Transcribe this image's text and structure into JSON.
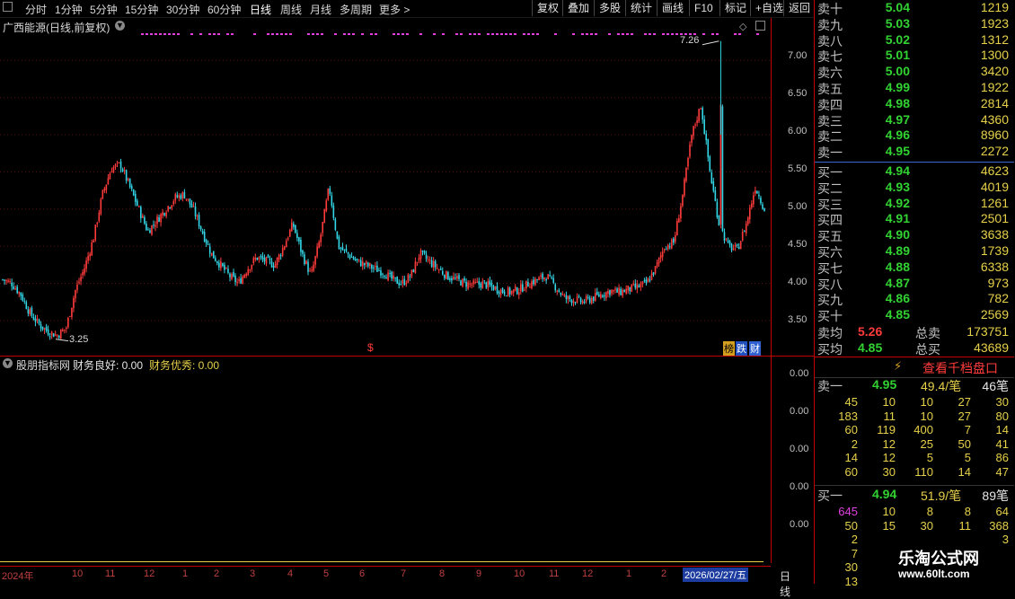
{
  "toolbar": {
    "periods": [
      "分时",
      "1分钟",
      "5分钟",
      "15分钟",
      "30分钟",
      "60分钟",
      "日线",
      "周线",
      "月线",
      "多周期",
      "更多 >"
    ],
    "active_period": "日线",
    "buttons": [
      "复权",
      "叠加",
      "多股",
      "统计",
      "画线",
      "F10",
      "标记",
      "+自选",
      "返回"
    ]
  },
  "chart": {
    "title": "广西能源(日线,前复权)",
    "high_label": "7.26",
    "low_label": "3.25",
    "price_axis": [
      "7.00",
      "6.50",
      "6.00",
      "5.50",
      "5.00",
      "4.50",
      "4.00",
      "3.50"
    ],
    "badge_1": "榜",
    "badge_2": "跌",
    "badge_3": "财",
    "marker": "$"
  },
  "indicator": {
    "name": "股朋指标网",
    "good_label": "财务良好: 0.00",
    "excellent_label": "财务优秀: 0.00",
    "axis": [
      "0.00",
      "0.00",
      "0.00",
      "0.00",
      "0.00"
    ]
  },
  "date_axis": {
    "year_label": "2024年",
    "ticks": [
      "10",
      "11",
      "12",
      "1",
      "2",
      "3",
      "4",
      "5",
      "6",
      "7",
      "8",
      "9",
      "10",
      "11",
      "12",
      "1",
      "2"
    ],
    "current_date": "2026/02/27/五",
    "period_label": "日线"
  },
  "orderbook": {
    "asks": [
      {
        "name": "卖十",
        "price": "5.04",
        "vol": "1219"
      },
      {
        "name": "卖九",
        "price": "5.03",
        "vol": "1923"
      },
      {
        "name": "卖八",
        "price": "5.02",
        "vol": "1312"
      },
      {
        "name": "卖七",
        "price": "5.01",
        "vol": "1300"
      },
      {
        "name": "卖六",
        "price": "5.00",
        "vol": "3420"
      },
      {
        "name": "卖五",
        "price": "4.99",
        "vol": "1922"
      },
      {
        "name": "卖四",
        "price": "4.98",
        "vol": "2814"
      },
      {
        "name": "卖三",
        "price": "4.97",
        "vol": "4360"
      },
      {
        "name": "卖二",
        "price": "4.96",
        "vol": "8960"
      },
      {
        "name": "卖一",
        "price": "4.95",
        "vol": "2272"
      }
    ],
    "bids": [
      {
        "name": "买一",
        "price": "4.94",
        "vol": "4623"
      },
      {
        "name": "买二",
        "price": "4.93",
        "vol": "4019"
      },
      {
        "name": "买三",
        "price": "4.92",
        "vol": "1261"
      },
      {
        "name": "买四",
        "price": "4.91",
        "vol": "2501"
      },
      {
        "name": "买五",
        "price": "4.90",
        "vol": "3638"
      },
      {
        "name": "买六",
        "price": "4.89",
        "vol": "1739"
      },
      {
        "name": "买七",
        "price": "4.88",
        "vol": "6338"
      },
      {
        "name": "买八",
        "price": "4.87",
        "vol": "973"
      },
      {
        "name": "买九",
        "price": "4.86",
        "vol": "782"
      },
      {
        "name": "买十",
        "price": "4.85",
        "vol": "2569"
      }
    ],
    "avg_sell": {
      "name": "卖均",
      "price": "5.26",
      "total_label": "总卖",
      "total": "173751"
    },
    "avg_buy": {
      "name": "买均",
      "price": "4.85",
      "total_label": "总买",
      "total": "43689"
    },
    "thousand_link": "查看千档盘口",
    "sell1_detail": {
      "name": "卖一",
      "price": "4.95",
      "avg": "49.4/笔",
      "count": "46笔",
      "grid": [
        [
          "45",
          "10",
          "10",
          "27",
          "30"
        ],
        [
          "183",
          "11",
          "10",
          "27",
          "80"
        ],
        [
          "60",
          "119",
          "400",
          "7",
          "14"
        ],
        [
          "2",
          "12",
          "25",
          "50",
          "41"
        ],
        [
          "14",
          "12",
          "5",
          "5",
          "86"
        ],
        [
          "60",
          "30",
          "110",
          "14",
          "47"
        ]
      ]
    },
    "buy1_detail": {
      "name": "买一",
      "price": "4.94",
      "avg": "51.9/笔",
      "count": "89笔",
      "grid": [
        [
          "645",
          "10",
          "8",
          "8",
          "64"
        ],
        [
          "50",
          "15",
          "30",
          "11",
          "368"
        ],
        [
          "2",
          "",
          "",
          "",
          "3"
        ],
        [
          "7",
          "",
          "",
          "",
          ""
        ],
        [
          "30",
          "",
          "",
          "",
          ""
        ],
        [
          "13",
          "",
          "",
          "",
          ""
        ]
      ]
    }
  },
  "ad": {
    "name": "乐淘公式网",
    "url": "www.60lt.com"
  },
  "colors": {
    "up": "#ff3b3b",
    "down": "#33d6e6",
    "grid_red": "#c00000",
    "magenta": "#e040e0",
    "yellow": "#e6d04a",
    "green": "#32d232"
  },
  "chart_data": {
    "type": "candlestick",
    "title": "广西能源(日线,前复权)",
    "x_labels": [
      "2024年",
      "10",
      "11",
      "12",
      "1",
      "2",
      "3",
      "4",
      "5",
      "6",
      "7",
      "8",
      "9",
      "10",
      "11",
      "12",
      "1",
      "2"
    ],
    "ylim": [
      3.1,
      7.45
    ],
    "y_ticks": [
      3.5,
      4.0,
      4.5,
      5.0,
      5.5,
      6.0,
      6.5,
      7.0
    ],
    "annotations": [
      {
        "label": "7.26",
        "value": 7.26
      },
      {
        "label": "3.25",
        "value": 3.25
      }
    ],
    "close_path": [
      4.05,
      4.0,
      3.85,
      3.6,
      3.45,
      3.35,
      3.3,
      3.4,
      3.9,
      4.2,
      4.6,
      5.2,
      5.55,
      5.6,
      5.3,
      5.0,
      4.7,
      4.85,
      5.0,
      5.15,
      5.2,
      5.0,
      4.7,
      4.4,
      4.25,
      4.1,
      4.0,
      4.2,
      4.35,
      4.3,
      4.25,
      4.5,
      4.8,
      4.4,
      4.1,
      4.6,
      5.3,
      4.5,
      4.4,
      4.3,
      4.25,
      4.2,
      4.15,
      4.05,
      4.0,
      4.1,
      4.4,
      4.3,
      4.2,
      4.1,
      4.05,
      4.0,
      3.98,
      4.0,
      3.95,
      3.9,
      3.88,
      3.92,
      4.0,
      4.05,
      4.1,
      3.95,
      3.8,
      3.78,
      3.75,
      3.8,
      3.85,
      3.9,
      3.88,
      3.92,
      3.95,
      4.0,
      4.2,
      4.5,
      4.55,
      5.2,
      6.0,
      6.4,
      5.5,
      4.8,
      4.5,
      4.45,
      4.8,
      5.3,
      5.0
    ]
  }
}
